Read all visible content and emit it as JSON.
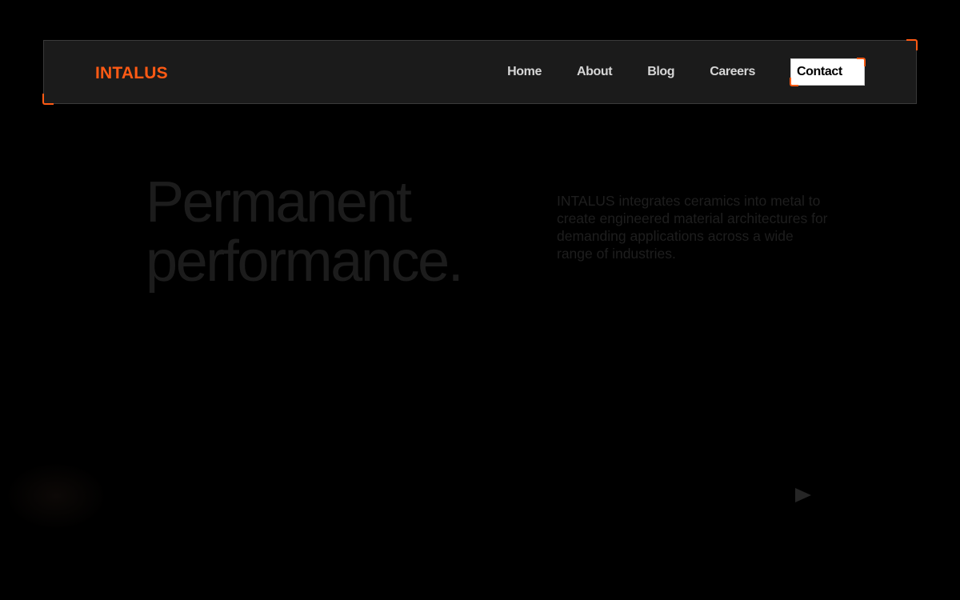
{
  "brand": {
    "name": "INTALUS",
    "accent_color": "#ff5a14"
  },
  "nav": {
    "items": [
      {
        "label": "Home"
      },
      {
        "label": "About"
      },
      {
        "label": "Blog"
      },
      {
        "label": "Careers"
      }
    ],
    "contact_label": "Contact"
  },
  "hero": {
    "title_line1": "Permanent",
    "title_line2": "performance.",
    "description": "INTALUS integrates ceramics into metal to create engineered material architectures for demanding applications across a wide range of industries."
  },
  "media": {
    "play_icon": "play-icon"
  }
}
